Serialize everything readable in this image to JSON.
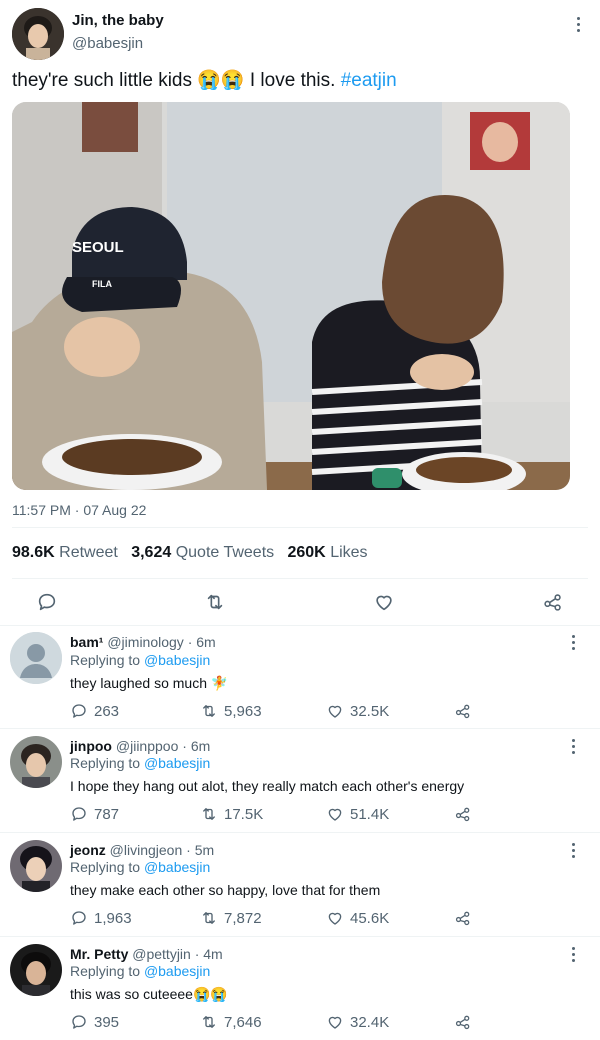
{
  "tweet": {
    "display_name": "Jin, the baby",
    "handle": "@babesjin",
    "text_before": "they're such little kids ",
    "emoji": "😭😭",
    "text_after": " I love this. ",
    "hashtag": "#eatjin",
    "photo_caps": {
      "cap_text": "SEOUL",
      "cap_brand": "FILA"
    },
    "timestamp": "11:57 PM · 07 Aug 22",
    "stats": {
      "retweets_count": "98.6K",
      "retweets_label": "Retweet",
      "quotes_count": "3,624",
      "quotes_label": "Quote Tweets",
      "likes_count": "260K",
      "likes_label": "Likes"
    }
  },
  "colors": {
    "accent": "#1d9bf0",
    "muted": "#536471",
    "divider": "#eff3f4"
  },
  "replies": [
    {
      "name": "bam¹",
      "handle": "@jiminology",
      "time": "· 6m",
      "replying_label": "Replying to",
      "replying_to": "@babesjin",
      "text": "they laughed so much 🧚",
      "comments": "263",
      "retweets": "5,963",
      "likes": "32.5K"
    },
    {
      "name": "jinpoo",
      "handle": "@jiinppoo",
      "time": "· 6m",
      "replying_label": "Replying to",
      "replying_to": "@babesjin",
      "text": "I hope they hang out alot, they really match each other's energy",
      "comments": "787",
      "retweets": "17.5K",
      "likes": "51.4K"
    },
    {
      "name": "jeonz",
      "handle": "@livingjeon",
      "time": "· 5m",
      "replying_label": "Replying to",
      "replying_to": "@babesjin",
      "text": "they make each other so happy, love that for them",
      "comments": "1,963",
      "retweets": "7,872",
      "likes": "45.6K"
    },
    {
      "name": "Mr. Petty",
      "handle": "@pettyjin",
      "time": "· 4m",
      "replying_label": "Replying to",
      "replying_to": "@babesjin",
      "text": "this was so cuteeee😭😭",
      "comments": "395",
      "retweets": "7,646",
      "likes": "32.4K"
    }
  ]
}
